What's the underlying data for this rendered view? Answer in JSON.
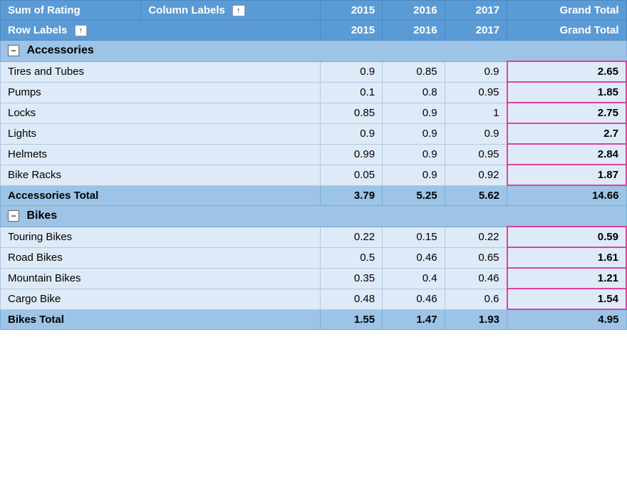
{
  "header": {
    "sum_of_rating": "Sum of Rating",
    "column_labels": "Column Labels",
    "row_labels": "Row Labels",
    "years": [
      "2015",
      "2016",
      "2017",
      "Grand Total"
    ]
  },
  "sections": [
    {
      "category": "Accessories",
      "items": [
        {
          "label": "Tires and Tubes",
          "y2015": "0.9",
          "y2016": "0.85",
          "y2017": "0.9",
          "grand": "2.65"
        },
        {
          "label": "Pumps",
          "y2015": "0.1",
          "y2016": "0.8",
          "y2017": "0.95",
          "grand": "1.85"
        },
        {
          "label": "Locks",
          "y2015": "0.85",
          "y2016": "0.9",
          "y2017": "1",
          "grand": "2.75"
        },
        {
          "label": "Lights",
          "y2015": "0.9",
          "y2016": "0.9",
          "y2017": "0.9",
          "grand": "2.7"
        },
        {
          "label": "Helmets",
          "y2015": "0.99",
          "y2016": "0.9",
          "y2017": "0.95",
          "grand": "2.84"
        },
        {
          "label": "Bike Racks",
          "y2015": "0.05",
          "y2016": "0.9",
          "y2017": "0.92",
          "grand": "1.87"
        }
      ],
      "total": {
        "label": "Accessories Total",
        "y2015": "3.79",
        "y2016": "5.25",
        "y2017": "5.62",
        "grand": "14.66"
      }
    },
    {
      "category": "Bikes",
      "items": [
        {
          "label": "Touring Bikes",
          "y2015": "0.22",
          "y2016": "0.15",
          "y2017": "0.22",
          "grand": "0.59"
        },
        {
          "label": "Road Bikes",
          "y2015": "0.5",
          "y2016": "0.46",
          "y2017": "0.65",
          "grand": "1.61"
        },
        {
          "label": "Mountain Bikes",
          "y2015": "0.35",
          "y2016": "0.4",
          "y2017": "0.46",
          "grand": "1.21"
        },
        {
          "label": "Cargo Bike",
          "y2015": "0.48",
          "y2016": "0.46",
          "y2017": "0.6",
          "grand": "1.54"
        }
      ],
      "total": {
        "label": "Bikes Total",
        "y2015": "1.55",
        "y2016": "1.47",
        "y2017": "1.93",
        "grand": "4.95"
      }
    }
  ]
}
